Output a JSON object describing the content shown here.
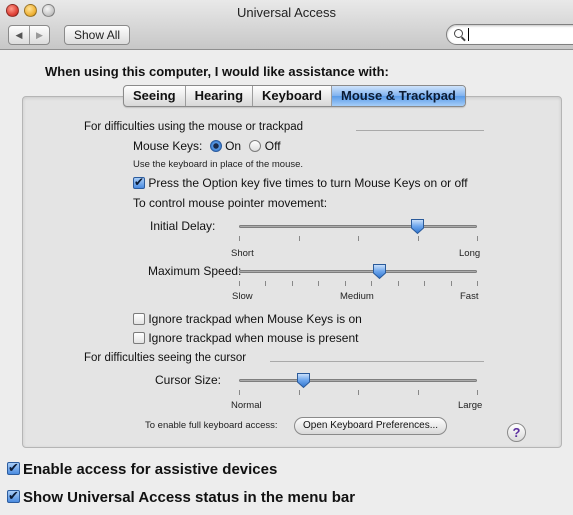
{
  "window": {
    "title": "Universal Access"
  },
  "toolbar": {
    "back_icon": "triangle-left-icon",
    "forward_icon": "triangle-right-icon",
    "show_all_label": "Show All",
    "search_value": "",
    "search_icon": "magnifier-icon"
  },
  "intro_text": "When using this computer, I would like assistance with:",
  "tabs": [
    {
      "label": "Seeing",
      "active": false
    },
    {
      "label": "Hearing",
      "active": false
    },
    {
      "label": "Keyboard",
      "active": false
    },
    {
      "label": "Mouse & Trackpad",
      "active": true
    }
  ],
  "mouse_section": {
    "heading": "For difficulties using the mouse or trackpad",
    "mouse_keys_label": "Mouse Keys:",
    "on_label": "On",
    "off_label": "Off",
    "mouse_keys_selected": "On",
    "mouse_keys_desc": "Use the keyboard in place of the mouse.",
    "option_key_label": "Press the Option key five times to turn Mouse Keys on or off",
    "option_key_checked": true,
    "pointer_heading": "To control mouse pointer movement:",
    "initial_delay": {
      "label": "Initial Delay:",
      "min_label": "Short",
      "max_label": "Long",
      "value": 0.75
    },
    "maximum_speed": {
      "label": "Maximum Speed:",
      "min_label": "Slow",
      "mid_label": "Medium",
      "max_label": "Fast",
      "value": 0.59
    },
    "ignore_trackpad_mousekeys": {
      "label": "Ignore trackpad when Mouse Keys is on",
      "checked": false
    },
    "ignore_trackpad_mouse": {
      "label": "Ignore trackpad when mouse is present",
      "checked": false
    }
  },
  "cursor_section": {
    "heading": "For difficulties seeing the cursor",
    "cursor_size": {
      "label": "Cursor Size:",
      "min_label": "Normal",
      "max_label": "Large",
      "value": 0.27
    },
    "keyboard_access_text": "To enable full keyboard access:",
    "keyboard_prefs_button": "Open Keyboard Preferences..."
  },
  "help_label": "?",
  "bottom": {
    "assistive_label": "Enable access for assistive devices",
    "assistive_checked": true,
    "status_label": "Show Universal Access status in the menu bar",
    "status_checked": true
  },
  "colors": {
    "accent": "#5a9be8",
    "help_glyph": "#5a2d9e"
  }
}
